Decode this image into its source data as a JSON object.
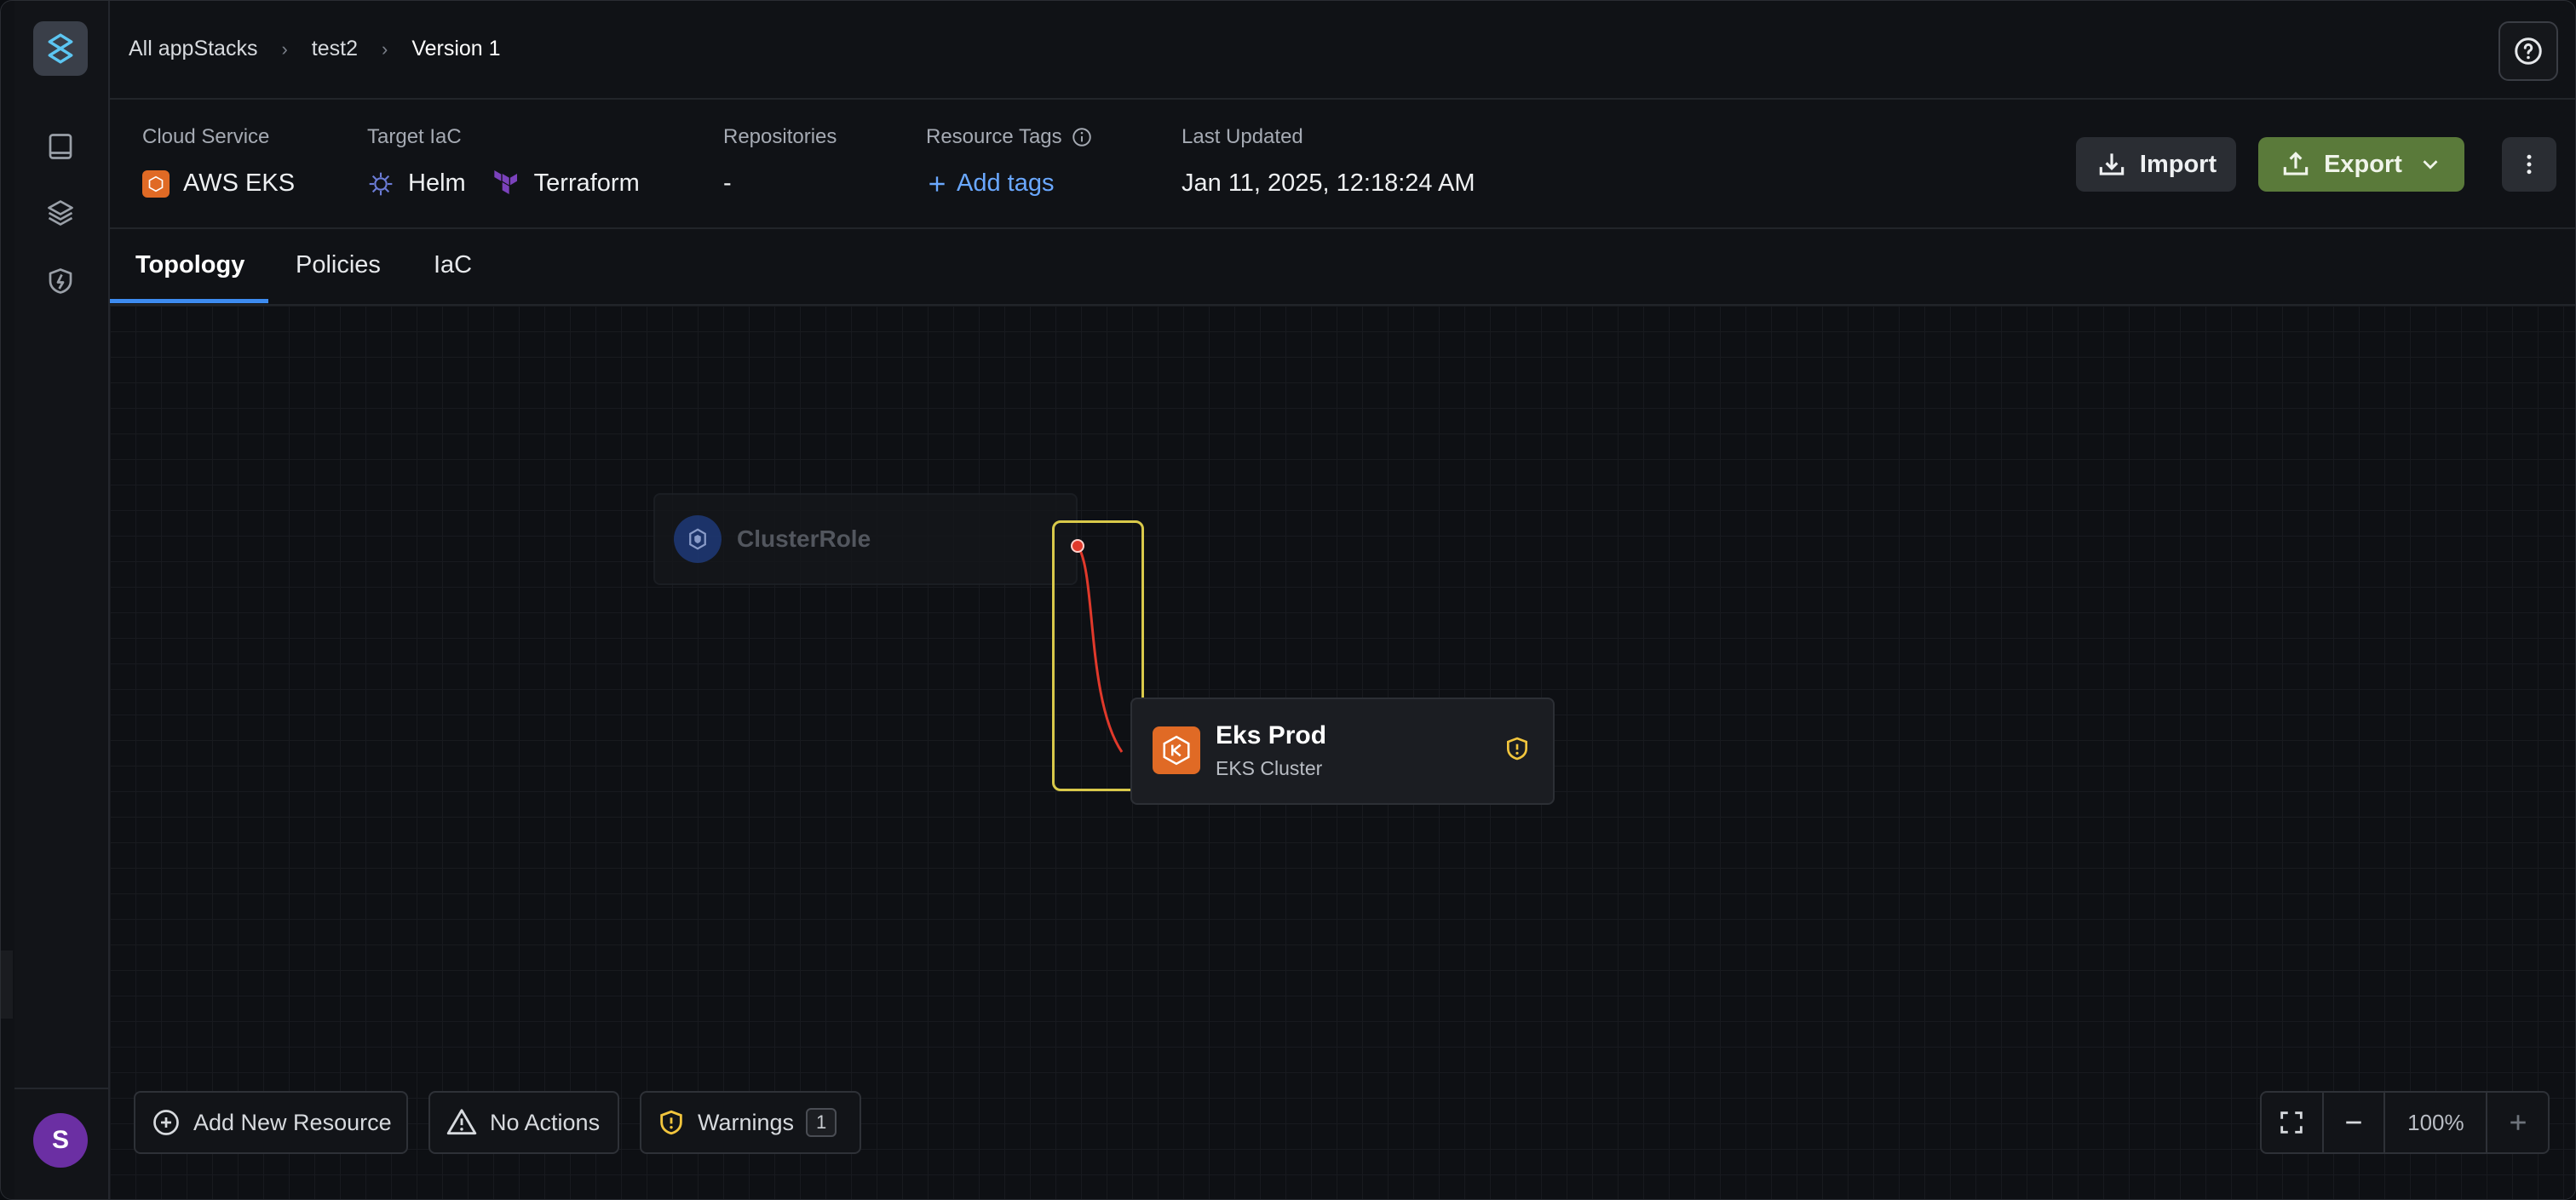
{
  "breadcrumb": {
    "items": [
      "All appStacks",
      "test2",
      "Version 1"
    ]
  },
  "header": {
    "help_icon": "question-circle-icon"
  },
  "meta": {
    "cloud_service": {
      "label": "Cloud Service",
      "value": "AWS EKS",
      "icon": "aws-eks-icon"
    },
    "target_iac": {
      "label": "Target IaC",
      "helm": "Helm",
      "terraform": "Terraform"
    },
    "repositories": {
      "label": "Repositories",
      "value": "-"
    },
    "resource_tags": {
      "label": "Resource Tags",
      "add": "Add tags"
    },
    "last_updated": {
      "label": "Last Updated",
      "value": "Jan 11, 2025, 12:18:24 AM"
    }
  },
  "actions": {
    "import": "Import",
    "export": "Export"
  },
  "tabs": {
    "topology": "Topology",
    "policies": "Policies",
    "iac": "IaC"
  },
  "canvas": {
    "clusterrole": {
      "label": "ClusterRole"
    },
    "eks_node": {
      "title": "Eks Prod",
      "subtitle": "EKS Cluster"
    }
  },
  "toolbar": {
    "add_resource": "Add New Resource",
    "no_actions": "No Actions",
    "warnings": "Warnings",
    "warnings_count": "1"
  },
  "zoom": {
    "level": "100%"
  },
  "user": {
    "initial": "S"
  },
  "colors": {
    "accent_blue": "#3d8bf0",
    "export_green": "#5a7a3a",
    "aws_orange": "#e06a25",
    "selection_yellow": "#d9c94a",
    "edge_red": "#e0392b"
  }
}
